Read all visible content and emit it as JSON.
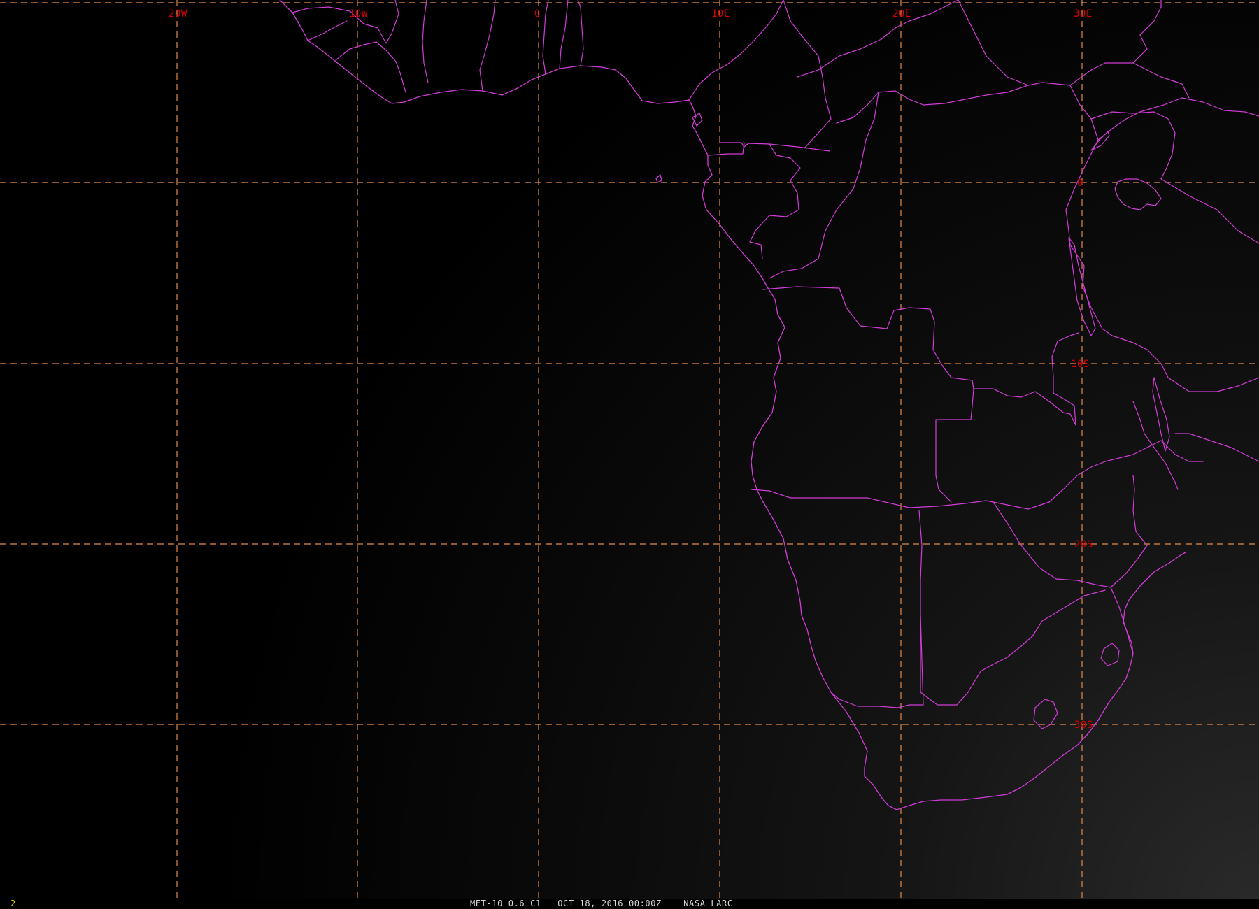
{
  "frame": {
    "number": "2",
    "number_color": "#e8e000"
  },
  "caption": {
    "satellite": "MET-10",
    "channel": "0.6 C1",
    "date": "OCT 18, 2016",
    "time": "00:00Z",
    "source": "NASA LARC"
  },
  "colors": {
    "background": "#000000",
    "boundary": "#d23cd8",
    "grid": "#e08a4a",
    "label": "#d80000"
  },
  "grid": {
    "longitude_labels": [
      "20W",
      "10W",
      "0",
      "10E",
      "20E",
      "30E"
    ],
    "latitude_labels": [
      "0",
      "10S",
      "20S",
      "30S"
    ]
  },
  "map": {
    "projection": "geostationary",
    "longitude_range_deg": [
      -30,
      40
    ],
    "latitude_range_deg": [
      -42,
      10
    ],
    "features": [
      "coastline",
      "country-borders",
      "lat-lon-grid"
    ]
  }
}
